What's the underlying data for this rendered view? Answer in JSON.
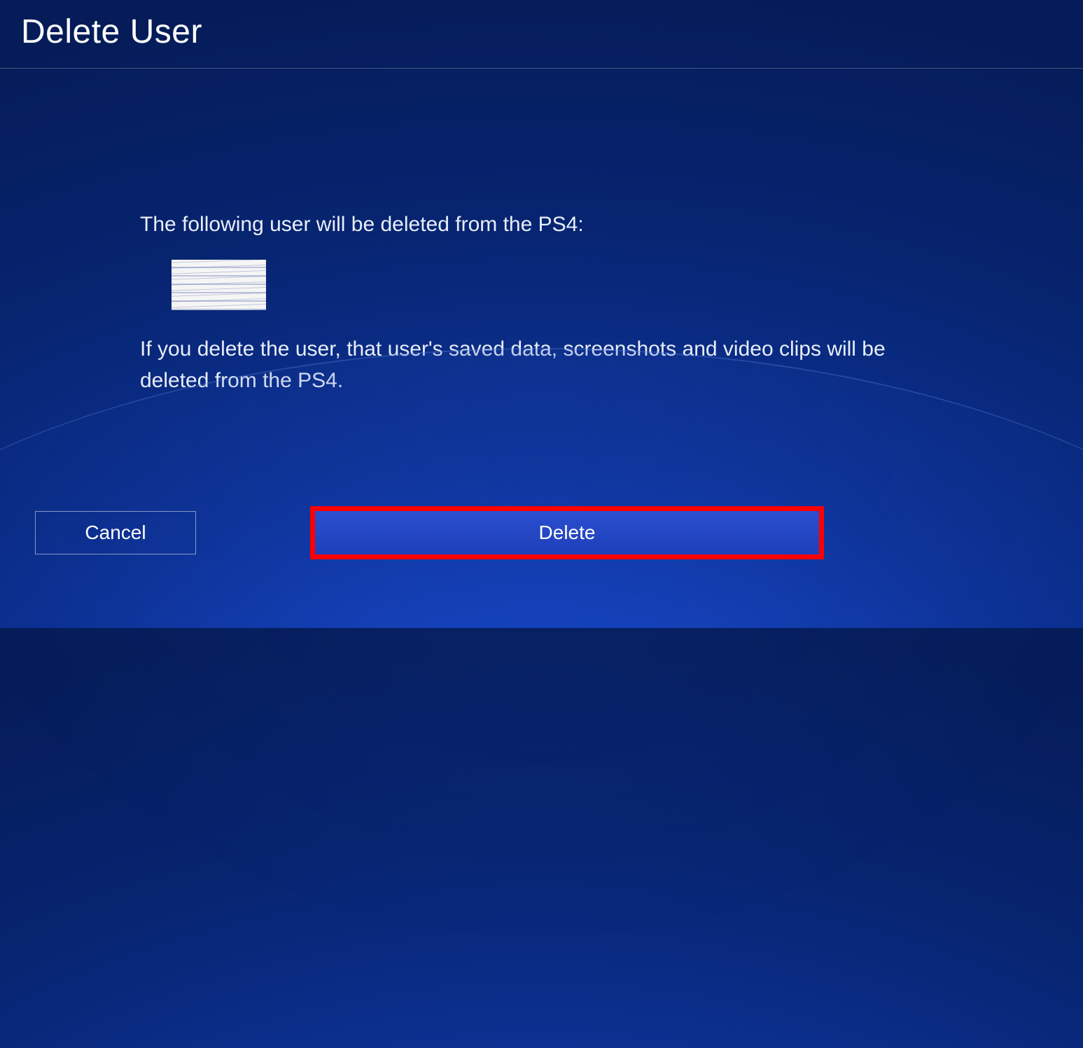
{
  "header": {
    "title": "Delete User"
  },
  "content": {
    "message": "The following user will be deleted from the PS4:",
    "warning": "If you delete the user, that user's saved data, screenshots and video clips will be deleted from the PS4."
  },
  "buttons": {
    "cancel_label": "Cancel",
    "delete_label": "Delete"
  }
}
